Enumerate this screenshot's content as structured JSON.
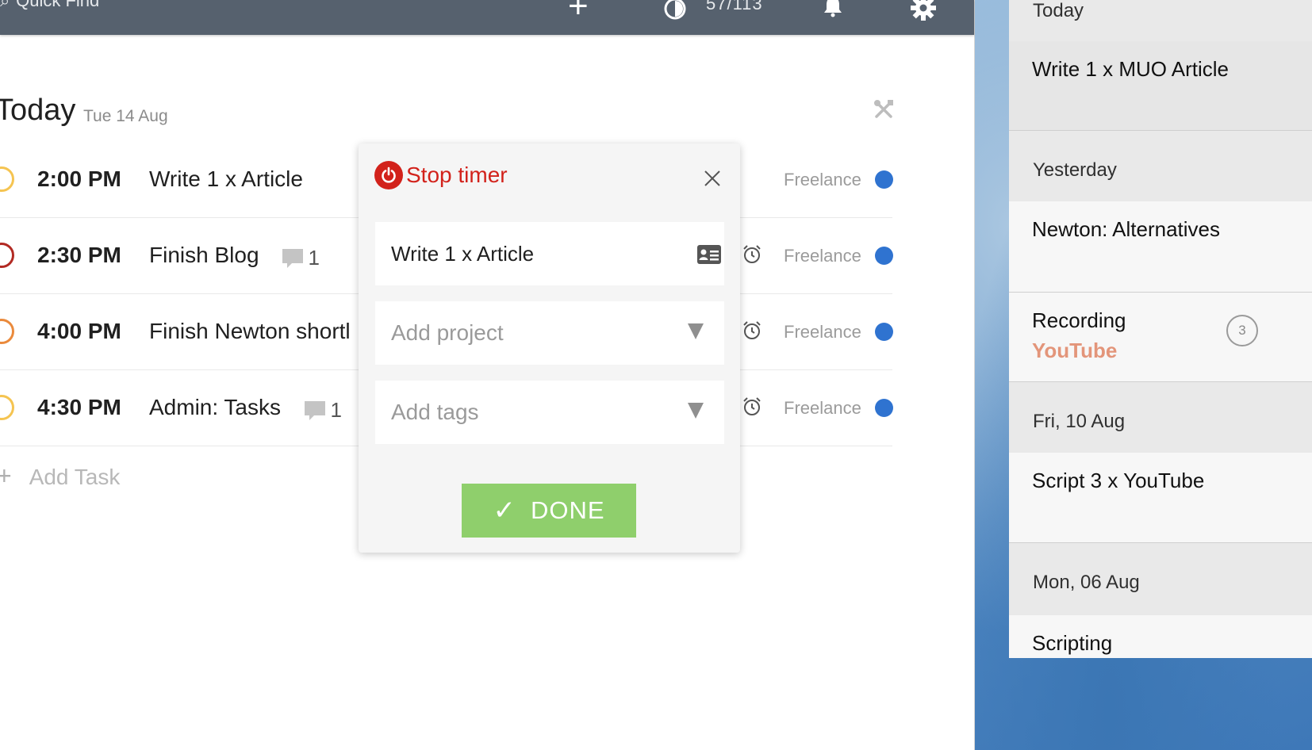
{
  "topbar": {
    "quick_find": "Quick Find",
    "karma_count": "57/113"
  },
  "header": {
    "title": "Today",
    "date": "Tue 14 Aug"
  },
  "tasks": [
    {
      "time": "2:00 PM",
      "title": "Write 1 x Article",
      "comments": "",
      "project": "Freelance",
      "circle_color": "#f5c451"
    },
    {
      "time": "2:30 PM",
      "title": "Finish Blog",
      "comments": "1",
      "project": "Freelance",
      "circle_color": "#b22a23"
    },
    {
      "time": "4:00 PM",
      "title": "Finish Newton shortl",
      "comments": "",
      "project": "Freelance",
      "circle_color": "#ea8a3c"
    },
    {
      "time": "4:30 PM",
      "title": "Admin: Tasks",
      "comments": "1",
      "project": "Freelance",
      "circle_color": "#f5c451"
    }
  ],
  "add_task": "Add Task",
  "project_color": "#2f73d0",
  "popup": {
    "stop_label": "Stop timer",
    "task_value": "Write 1 x Article",
    "project_placeholder": "Add project",
    "tags_placeholder": "Add tags",
    "done_label": "DONE"
  },
  "panel": {
    "sections": [
      {
        "header": "Today",
        "items": [
          {
            "title": "Write 1 x MUO Article",
            "sub": ""
          }
        ]
      },
      {
        "header": "Yesterday",
        "items": [
          {
            "title": "Newton: Alternatives",
            "sub": ""
          },
          {
            "title": "Recording",
            "sub": "YouTube",
            "badge": "3"
          }
        ]
      },
      {
        "header": "Fri, 10 Aug",
        "items": [
          {
            "title": "Script 3 x YouTube",
            "sub": ""
          }
        ]
      },
      {
        "header": "Mon, 06 Aug",
        "items": [
          {
            "title": "Scripting",
            "sub": ""
          }
        ]
      }
    ]
  },
  "colors": {
    "topbar": "#56616e",
    "stop_red": "#d2221b",
    "done_green": "#8fcf6c",
    "youtube_orange": "#e3957a"
  }
}
